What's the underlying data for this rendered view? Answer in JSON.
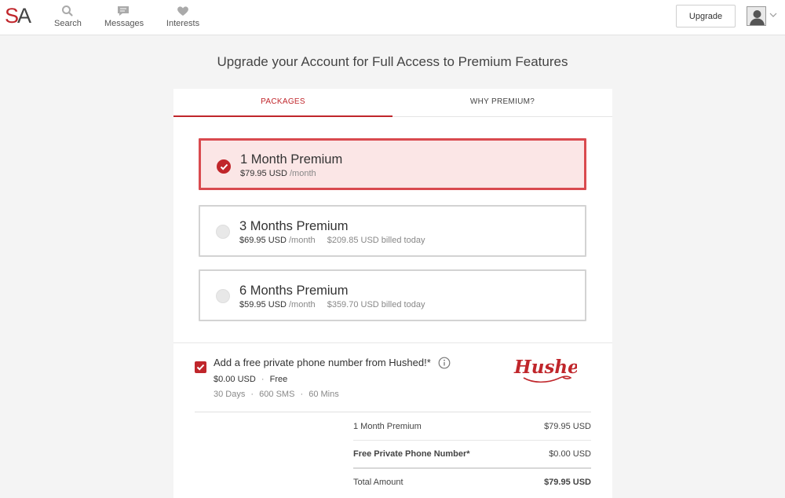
{
  "header": {
    "logo_s": "S",
    "logo_a": "A",
    "nav": [
      {
        "label": "Search",
        "icon": "search-icon"
      },
      {
        "label": "Messages",
        "icon": "messages-icon"
      },
      {
        "label": "Interests",
        "icon": "heart-icon"
      }
    ],
    "upgrade_label": "Upgrade"
  },
  "page": {
    "title": "Upgrade your Account for Full Access to Premium Features"
  },
  "tabs": [
    {
      "label": "PACKAGES",
      "active": true
    },
    {
      "label": "WHY PREMIUM?",
      "active": false
    }
  ],
  "packages": [
    {
      "name": "1 Month Premium",
      "price": "$79.95 USD",
      "per": "/month",
      "billed": "",
      "selected": true
    },
    {
      "name": "3 Months Premium",
      "price": "$69.95 USD",
      "per": "/month",
      "billed": "$209.85 USD billed today",
      "selected": false
    },
    {
      "name": "6 Months Premium",
      "price": "$59.95 USD",
      "per": "/month",
      "billed": "$359.70 USD billed today",
      "selected": false
    }
  ],
  "addon": {
    "checked": true,
    "title": "Add a free private phone number from Hushed!*",
    "price": "$0.00 USD",
    "price_note": "Free",
    "specs": [
      "30 Days",
      "600 SMS",
      "60 Mins"
    ],
    "brand": "Hushed"
  },
  "summary": {
    "rows": [
      {
        "label": "1 Month Premium",
        "amount": "$79.95 USD"
      },
      {
        "label": "Free Private Phone Number*",
        "amount": "$0.00 USD"
      }
    ],
    "total": {
      "label": "Total Amount",
      "amount": "$79.95 USD"
    }
  },
  "colors": {
    "accent": "#c0262b",
    "selected_bg": "#fbe6e6",
    "selected_border": "#d94a4f",
    "page_bg": "#f4f4f4"
  }
}
